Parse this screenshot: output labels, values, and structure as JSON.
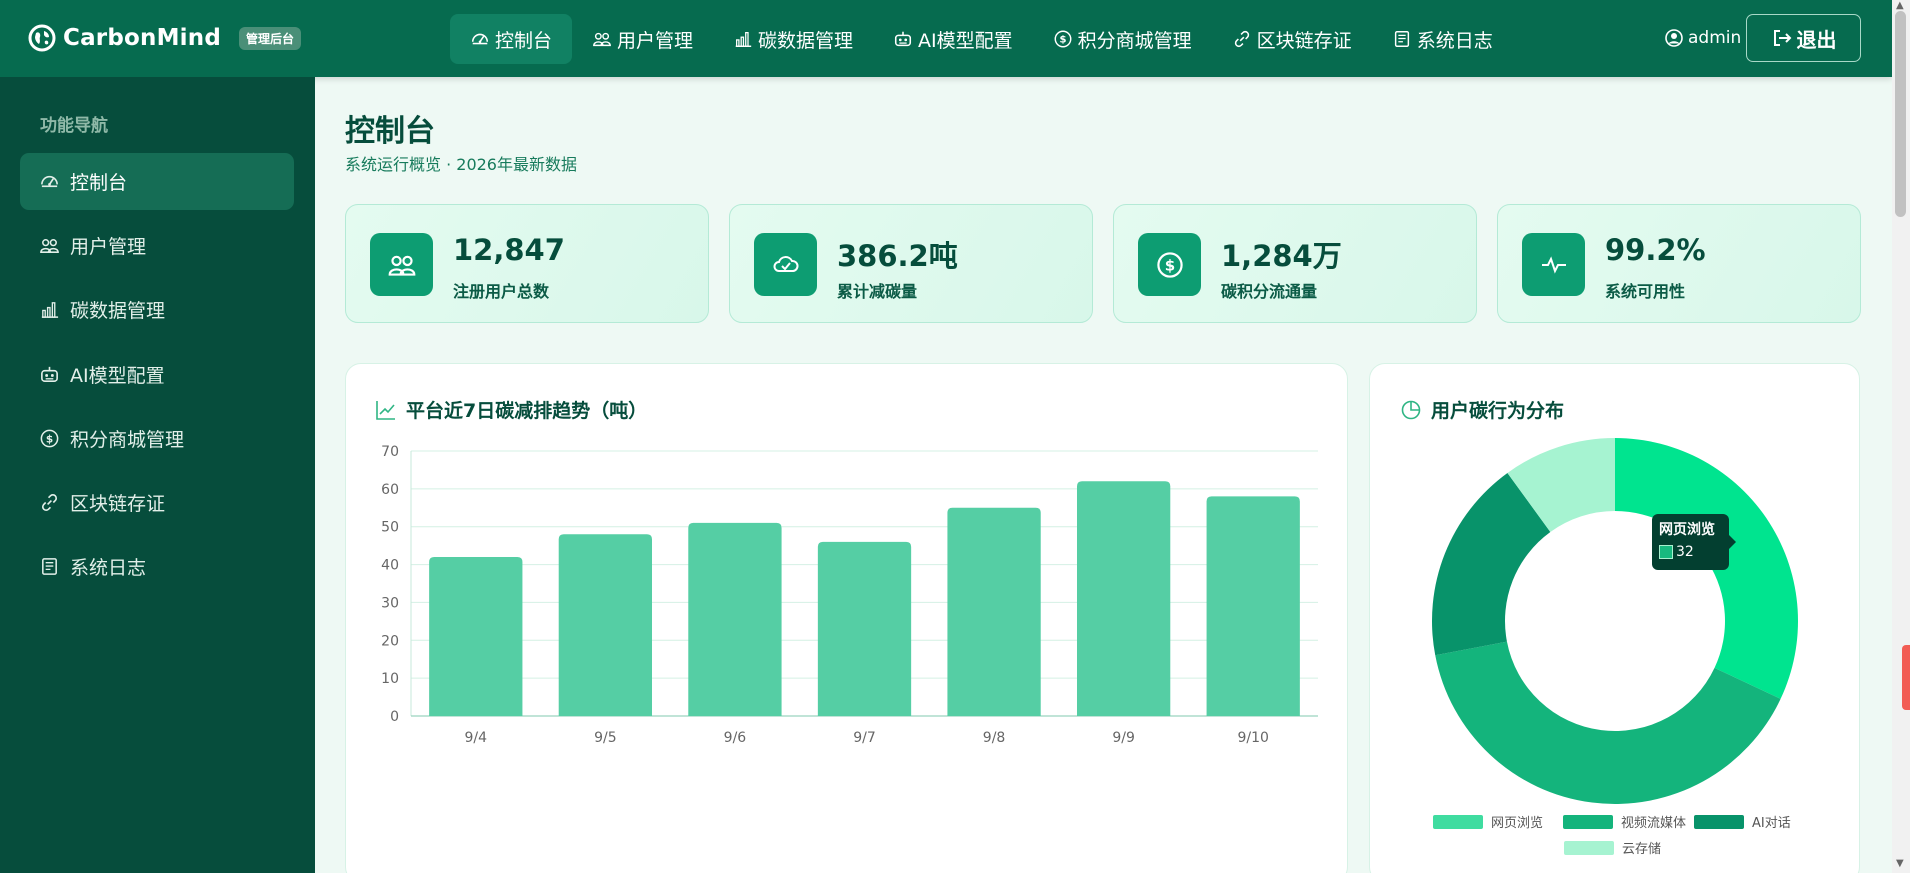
{
  "brand": {
    "name": "CarbonMind",
    "badge": "管理后台"
  },
  "topnav": [
    {
      "label": "控制台",
      "icon": "gauge-icon",
      "active": true
    },
    {
      "label": "用户管理",
      "icon": "users-icon"
    },
    {
      "label": "碳数据管理",
      "icon": "bar-chart-icon"
    },
    {
      "label": "AI模型配置",
      "icon": "robot-icon"
    },
    {
      "label": "积分商城管理",
      "icon": "coin-icon"
    },
    {
      "label": "区块链存证",
      "icon": "link-icon"
    },
    {
      "label": "系统日志",
      "icon": "log-icon"
    }
  ],
  "user": {
    "name": "admin",
    "logout_label": "退出"
  },
  "sidebar": {
    "heading": "功能导航",
    "items": [
      {
        "label": "控制台",
        "icon": "gauge-icon",
        "active": true
      },
      {
        "label": "用户管理",
        "icon": "users-icon"
      },
      {
        "label": "碳数据管理",
        "icon": "bar-chart-icon"
      },
      {
        "label": "AI模型配置",
        "icon": "robot-icon"
      },
      {
        "label": "积分商城管理",
        "icon": "coin-icon"
      },
      {
        "label": "区块链存证",
        "icon": "link-icon"
      },
      {
        "label": "系统日志",
        "icon": "log-icon"
      }
    ]
  },
  "page": {
    "title": "控制台",
    "subtitle": "系统运行概览 · 2026年最新数据"
  },
  "stats": [
    {
      "value": "12,847",
      "label": "注册用户总数",
      "icon": "users-icon"
    },
    {
      "value": "386.2吨",
      "label": "累计减碳量",
      "icon": "cloud-check-icon"
    },
    {
      "value": "1,284万",
      "label": "碳积分流通量",
      "icon": "coin-icon"
    },
    {
      "value": "99.2%",
      "label": "系统可用性",
      "icon": "activity-icon"
    }
  ],
  "bar_panel": {
    "title": "平台近7日碳减排趋势（吨）"
  },
  "pie_panel": {
    "title": "用户碳行为分布",
    "tooltip": {
      "title": "网页浏览",
      "value": "32"
    }
  },
  "colors": {
    "header": "#066b4f",
    "sidebar": "#064d3c",
    "accent": "#0d9d72",
    "bar": "#55ceA4"
  },
  "chart_data": [
    {
      "type": "bar",
      "title": "平台近7日碳减排趋势（吨）",
      "categories": [
        "9/4",
        "9/5",
        "9/6",
        "9/7",
        "9/8",
        "9/9",
        "9/10"
      ],
      "values": [
        42,
        48,
        51,
        46,
        55,
        62,
        58
      ],
      "ylim": [
        0,
        70
      ],
      "yticks": [
        0,
        10,
        20,
        30,
        40,
        50,
        60,
        70
      ],
      "grid": true,
      "color": "#55cea4"
    },
    {
      "type": "pie",
      "title": "用户碳行为分布",
      "donut": true,
      "slices": [
        {
          "name": "网页浏览",
          "value": 32,
          "color": "#00e48f"
        },
        {
          "name": "视频流媒体",
          "value": 40,
          "color": "#14b47c"
        },
        {
          "name": "AI对话",
          "value": 18,
          "color": "#08936a"
        },
        {
          "name": "云存储",
          "value": 10,
          "color": "#a6f3d1"
        }
      ],
      "legend_position": "bottom"
    }
  ]
}
